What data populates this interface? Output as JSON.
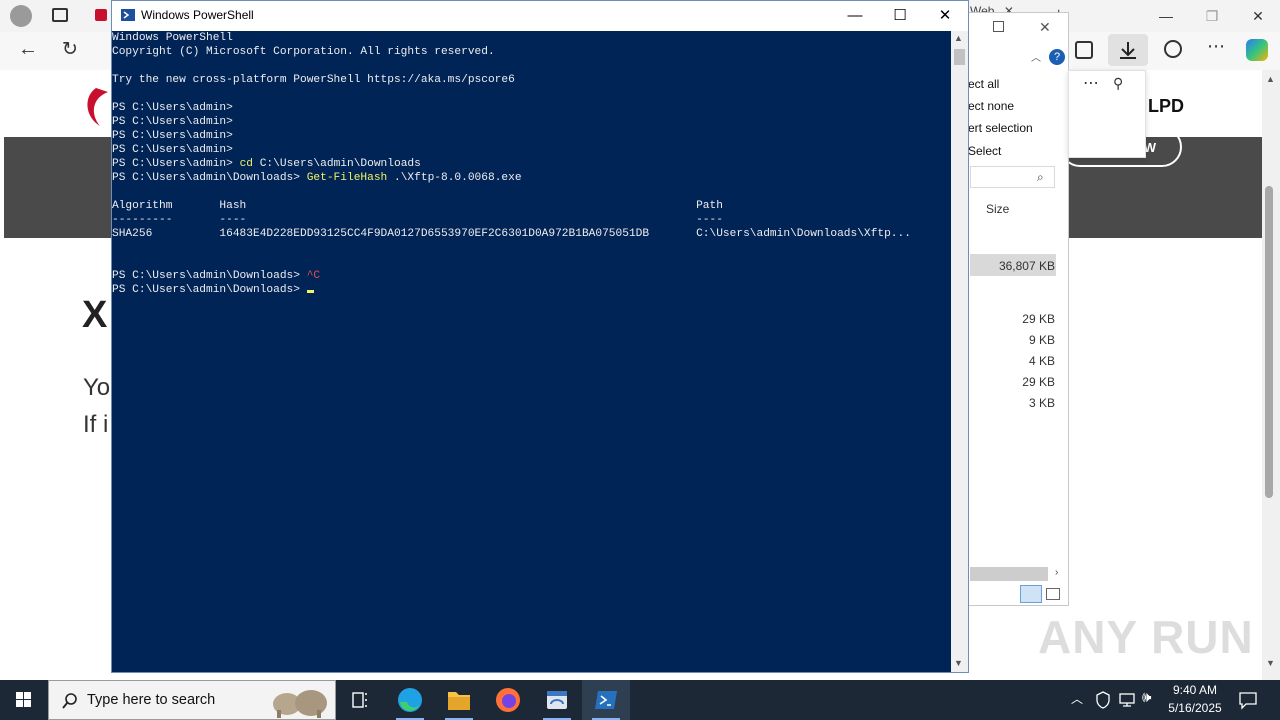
{
  "browser": {
    "tab_ghost_label": "Web",
    "page_logo_text": "LPD",
    "page_button_label": "W",
    "page_heading_fragment": "X",
    "page_text_line1": "Yo",
    "page_text_line2": "If i",
    "colors": {
      "band": "#4a4a4a"
    }
  },
  "explorer": {
    "menu_items": [
      "ect all",
      "ect none",
      "ert selection",
      "Select"
    ],
    "size_header": "Size",
    "sizes": [
      "36,807 KB",
      "29 KB",
      "9 KB",
      "4 KB",
      "29 KB",
      "3 KB"
    ]
  },
  "powershell": {
    "title": "Windows PowerShell",
    "lines": [
      "Windows PowerShell",
      "Copyright (C) Microsoft Corporation. All rights reserved.",
      "",
      "Try the new cross-platform PowerShell https://aka.ms/pscore6",
      "",
      "PS C:\\Users\\admin>",
      "PS C:\\Users\\admin>",
      "PS C:\\Users\\admin>",
      "PS C:\\Users\\admin>"
    ],
    "cd_prompt": "PS C:\\Users\\admin> ",
    "cd_cmd": "cd",
    "cd_arg": " C:\\Users\\admin\\Downloads",
    "hash_prompt": "PS C:\\Users\\admin\\Downloads> ",
    "hash_cmd": "Get-FileHash",
    "hash_arg": " .\\Xftp-8.0.0068.exe",
    "table_header": "Algorithm       Hash                                                                   Path",
    "table_rule": "---------       ----                                                                   ----",
    "table_row": "SHA256          16483E4D228EDD93125CC4F9DA0127D6553970EF2C6301D0A972B1BA075051DB       C:\\Users\\admin\\Downloads\\Xftp...",
    "ctrlc_prompt": "PS C:\\Users\\admin\\Downloads> ",
    "ctrlc_text": "^C",
    "final_prompt": "PS C:\\Users\\admin\\Downloads> ",
    "colors": {
      "console_bg": "#012456",
      "text": "#eeedf0",
      "command": "#f2f267",
      "ctrlc": "#e84b4b"
    }
  },
  "taskbar": {
    "search_placeholder": "Type here to search",
    "apps": [
      "task-view",
      "edge",
      "file-explorer",
      "firefox",
      "app-window",
      "powershell"
    ],
    "time": "9:40 AM",
    "date": "5/16/2025"
  },
  "watermark": "ANY RUN"
}
